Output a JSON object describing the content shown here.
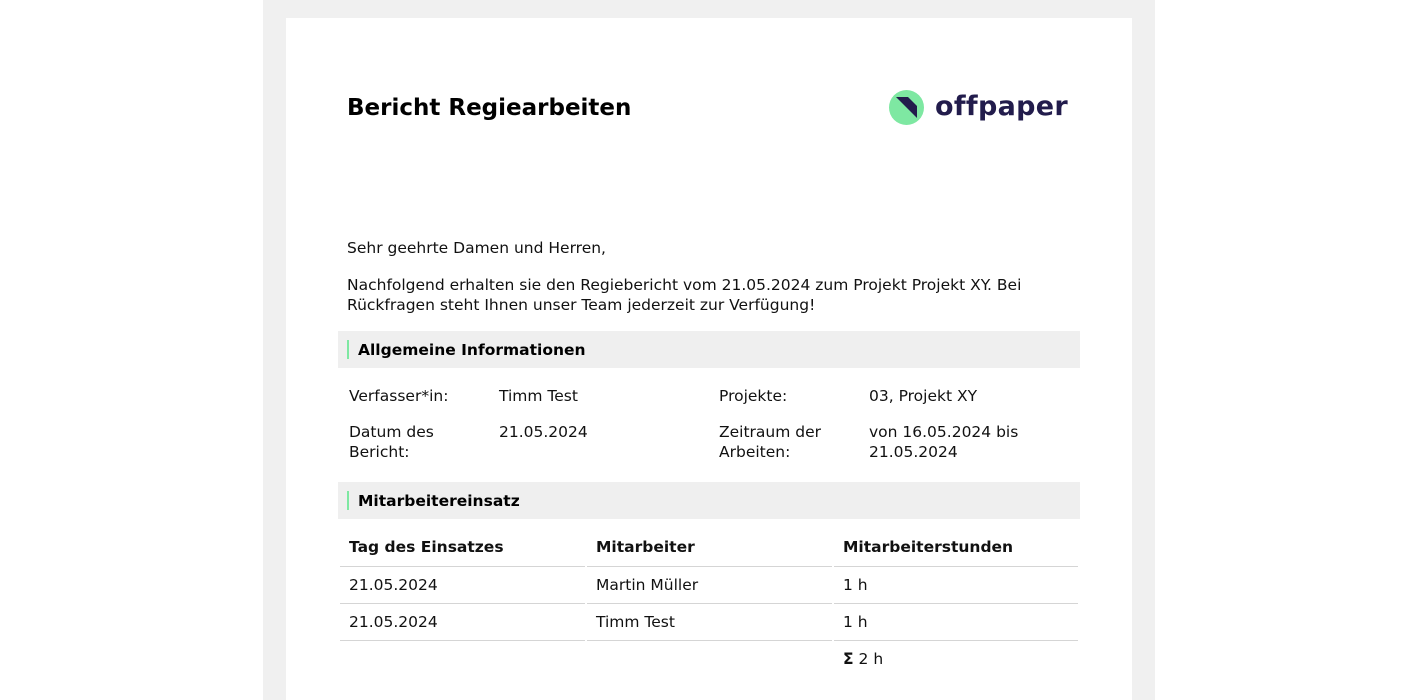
{
  "report": {
    "title": "Bericht Regiearbeiten",
    "logo_text": "offpaper",
    "greeting": "Sehr geehrte Damen und Herren,",
    "intro": "Nachfolgend erhalten sie den Regiebericht vom 21.05.2024 zum Projekt Projekt XY. Bei Rückfragen steht Ihnen unser Team jederzeit zur Verfügung!"
  },
  "general_info": {
    "heading": "Allgemeine Informationen",
    "author_label": "Verfasser*in:",
    "author_value": "Timm Test",
    "projects_label": "Projekte:",
    "projects_value": "03, Projekt XY",
    "date_label": "Datum des Bericht:",
    "date_value": "21.05.2024",
    "period_label": "Zeitraum der Arbeiten:",
    "period_value": "von 16.05.2024 bis 21.05.2024"
  },
  "staff": {
    "heading": "Mitarbeitereinsatz",
    "columns": [
      "Tag des Einsatzes",
      "Mitarbeiter",
      "Mitarbeiterstunden"
    ],
    "rows": [
      [
        "21.05.2024",
        "Martin Müller",
        "1 h"
      ],
      [
        "21.05.2024",
        "Timm Test",
        "1 h"
      ]
    ],
    "sum_symbol": "Σ",
    "sum_value": "2 h"
  },
  "colors": {
    "brand_green": "#7ee8a2",
    "brand_navy": "#221c4c",
    "section_bg": "#efefef"
  },
  "icons": {
    "logo": "offpaper-logo-icon"
  }
}
